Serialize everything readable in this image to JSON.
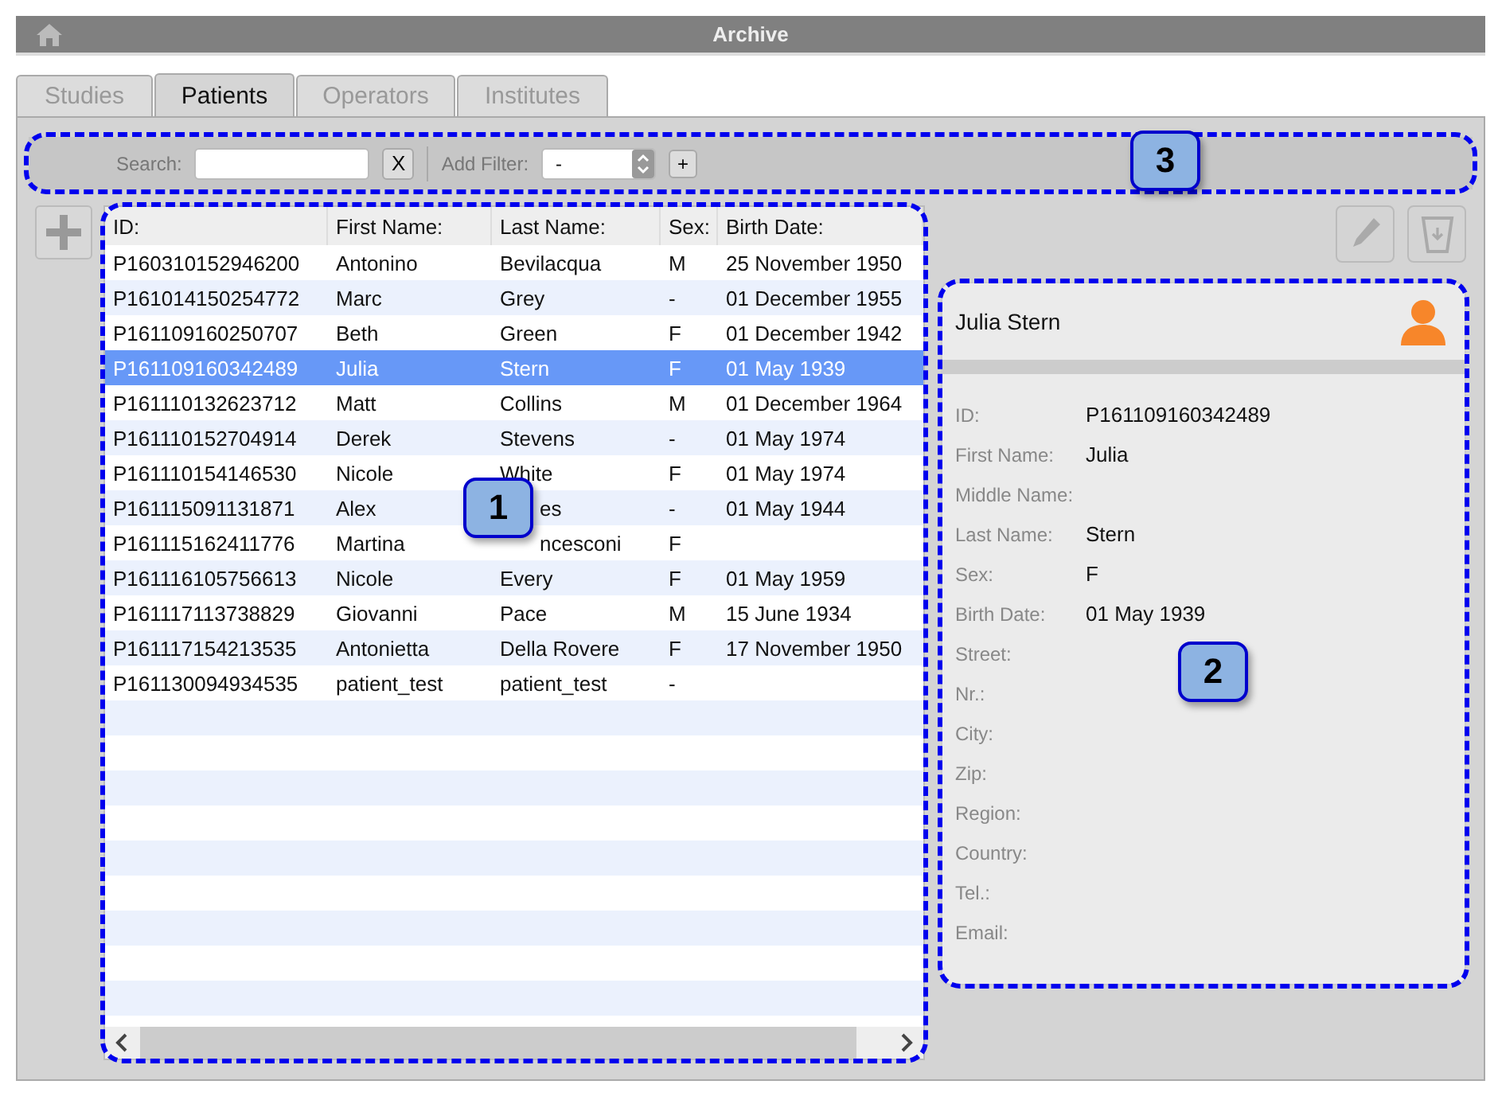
{
  "window": {
    "title": "Archive"
  },
  "tabs": [
    {
      "label": "Studies",
      "selected": false
    },
    {
      "label": "Patients",
      "selected": true
    },
    {
      "label": "Operators",
      "selected": false
    },
    {
      "label": "Institutes",
      "selected": false
    }
  ],
  "filter_bar": {
    "search_label": "Search:",
    "clear_button": "X",
    "filter_label": "Add Filter:",
    "filter_value": "-",
    "add_button": "+",
    "callout": "3"
  },
  "table": {
    "callout": "1",
    "columns": [
      "ID:",
      "First Name:",
      "Last Name:",
      "Sex:",
      "Birth Date:"
    ],
    "rows": [
      {
        "cells": [
          "P160310152946200",
          "Antonino",
          "Bevilacqua",
          "M",
          "25 November 1950"
        ],
        "selected": false,
        "last_name_covered": false
      },
      {
        "cells": [
          "P161014150254772",
          "Marc",
          "Grey",
          "-",
          "01 December 1955"
        ],
        "selected": false,
        "last_name_covered": false
      },
      {
        "cells": [
          "P161109160250707",
          "Beth",
          "Green",
          "F",
          "01 December 1942"
        ],
        "selected": false,
        "last_name_covered": false
      },
      {
        "cells": [
          "P161109160342489",
          "Julia",
          "Stern",
          "F",
          "01 May 1939"
        ],
        "selected": true,
        "last_name_covered": false
      },
      {
        "cells": [
          "P161110132623712",
          "Matt",
          "Collins",
          "M",
          "01 December 1964"
        ],
        "selected": false,
        "last_name_covered": false
      },
      {
        "cells": [
          "P161110152704914",
          "Derek",
          "Stevens",
          "-",
          "01 May 1974"
        ],
        "selected": false,
        "last_name_covered": false
      },
      {
        "cells": [
          "P161110154146530",
          "Nicole",
          "White",
          "F",
          "01 May 1974"
        ],
        "selected": false,
        "last_name_covered": false
      },
      {
        "cells": [
          "P161115091131871",
          "Alex",
          "es",
          "-",
          "01 May 1944"
        ],
        "selected": false,
        "last_name_covered": true
      },
      {
        "cells": [
          "P161115162411776",
          "Martina",
          "ncesconi",
          "F",
          ""
        ],
        "selected": false,
        "last_name_covered": true
      },
      {
        "cells": [
          "P161116105756613",
          "Nicole",
          "Every",
          "F",
          "01 May 1959"
        ],
        "selected": false,
        "last_name_covered": false
      },
      {
        "cells": [
          "P161117113738829",
          "Giovanni",
          "Pace",
          "M",
          "15 June 1934"
        ],
        "selected": false,
        "last_name_covered": false
      },
      {
        "cells": [
          "P161117154213535",
          "Antonietta",
          "Della Rovere",
          "F",
          "17 November 1950"
        ],
        "selected": false,
        "last_name_covered": false
      },
      {
        "cells": [
          "P161130094934535",
          "patient_test",
          "patient_test",
          "-",
          ""
        ],
        "selected": false,
        "last_name_covered": false
      }
    ]
  },
  "details": {
    "name": "Julia Stern",
    "callout": "2",
    "fields": [
      {
        "label": "ID:",
        "value": "P161109160342489"
      },
      {
        "label": "First Name:",
        "value": "Julia"
      },
      {
        "label": "Middle Name:"
      },
      {
        "label": "Last Name:",
        "value": "Stern"
      },
      {
        "label": "Sex:",
        "value": "F"
      },
      {
        "label": "Birth Date:",
        "value": "01 May 1939"
      },
      {
        "label": "Street:"
      },
      {
        "label": "Nr.:"
      },
      {
        "label": "City:"
      },
      {
        "label": "Zip:"
      },
      {
        "label": "Region:"
      },
      {
        "label": "Country:"
      },
      {
        "label": "Tel.:"
      },
      {
        "label": "Email:"
      }
    ]
  }
}
